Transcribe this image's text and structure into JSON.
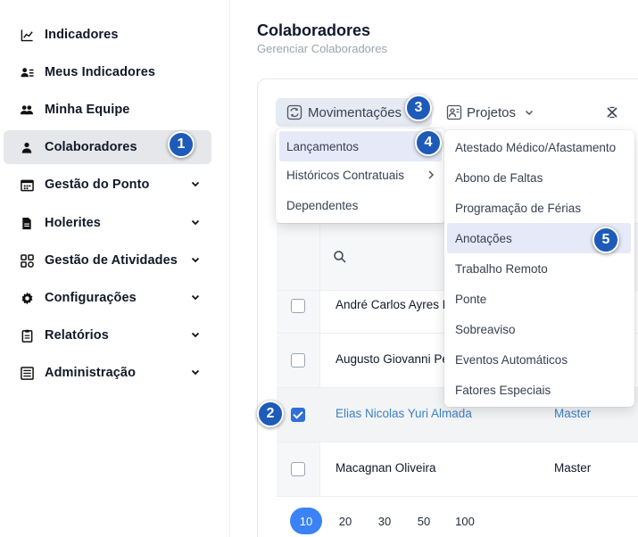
{
  "sidebar": {
    "items": [
      {
        "label": "Indicadores",
        "icon": "chart-line-icon",
        "chevron": false,
        "active": false
      },
      {
        "label": "Meus Indicadores",
        "icon": "user-list-icon",
        "chevron": false,
        "active": false
      },
      {
        "label": "Minha Equipe",
        "icon": "users-icon",
        "chevron": false,
        "active": false
      },
      {
        "label": "Colaboradores",
        "icon": "user-icon",
        "chevron": false,
        "active": true
      },
      {
        "label": "Gestão do Ponto",
        "icon": "calendar-icon",
        "chevron": true,
        "active": false
      },
      {
        "label": "Holerites",
        "icon": "document-icon",
        "chevron": true,
        "active": false
      },
      {
        "label": "Gestão de Atividades",
        "icon": "grid-icon",
        "chevron": true,
        "active": false
      },
      {
        "label": "Configurações",
        "icon": "gear-icon",
        "chevron": true,
        "active": false
      },
      {
        "label": "Relatórios",
        "icon": "clipboard-icon",
        "chevron": true,
        "active": false
      },
      {
        "label": "Administração",
        "icon": "admin-list-icon",
        "chevron": true,
        "active": false
      }
    ]
  },
  "header": {
    "title": "Colaboradores",
    "subtitle": "Gerenciar Colaboradores"
  },
  "toolbar": {
    "movimentacoes_label": "Movimentações",
    "projetos_label": "Projetos"
  },
  "menu_movimentacoes": {
    "items": [
      "Lançamentos",
      "Históricos Contratuais",
      "Dependentes"
    ]
  },
  "menu_lancamentos": {
    "items": [
      "Atestado Médico/Afastamento",
      "Abono de Faltas",
      "Programação de Férias",
      "Anotações",
      "Trabalho Remoto",
      "Ponte",
      "Sobreaviso",
      "Eventos Automáticos",
      "Fatores Especiais"
    ]
  },
  "table": {
    "rows": [
      {
        "name": "André Carlos Ayres R",
        "role": "",
        "selected": false
      },
      {
        "name": "Augusto Giovanni Pe",
        "role": "",
        "selected": false
      },
      {
        "name": "Elias Nicolas Yuri Almada",
        "role": "Master",
        "selected": true
      },
      {
        "name": "Macagnan Oliveira",
        "role": "Master",
        "selected": false
      }
    ]
  },
  "pagination": {
    "options": [
      "10",
      "20",
      "30",
      "50",
      "100"
    ],
    "selected": "10"
  },
  "steps": [
    "1",
    "2",
    "3",
    "4",
    "5"
  ],
  "colors": {
    "accent": "#3b82f6",
    "badge": "#1e5bb8",
    "selected_text": "#3b82c4",
    "menu_highlight": "#e6eaf8"
  }
}
